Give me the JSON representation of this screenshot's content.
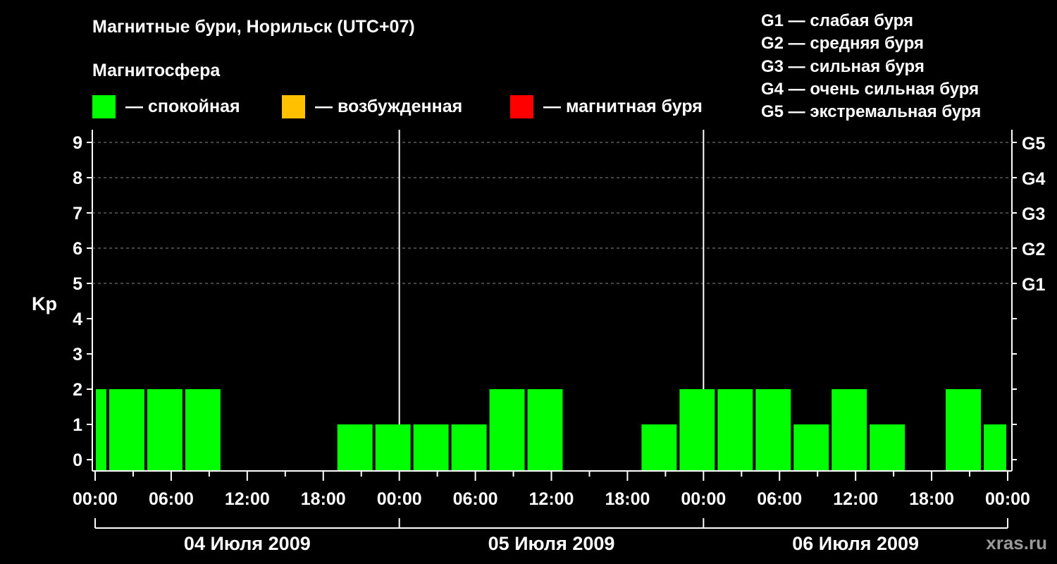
{
  "title": "Магнитные бури, Норильск (UTC+07)",
  "subtitle": "Магнитосфера",
  "legend": [
    {
      "label": "— спокойная",
      "color": "#00ff00"
    },
    {
      "label": "— возбужденная",
      "color": "#ffc000"
    },
    {
      "label": "— магнитная буря",
      "color": "#ff0000"
    }
  ],
  "g_legend": [
    "G1 — слабая буря",
    "G2 — средняя буря",
    "G3 — сильная буря",
    "G4 — очень сильная буря",
    "G5 — экстремальная буря"
  ],
  "watermark": "xras.ru",
  "chart_data": {
    "type": "bar",
    "ylabel": "Kp",
    "ylim": [
      0,
      9
    ],
    "y_ticks": [
      "0",
      "1",
      "2",
      "3",
      "4",
      "5",
      "6",
      "7",
      "8",
      "9"
    ],
    "right_ticks": [
      {
        "value": 5,
        "label": "G1"
      },
      {
        "value": 6,
        "label": "G2"
      },
      {
        "value": 7,
        "label": "G3"
      },
      {
        "value": 8,
        "label": "G4"
      },
      {
        "value": 9,
        "label": "G5"
      }
    ],
    "x_tick_labels": [
      "00:00",
      "06:00",
      "12:00",
      "18:00",
      "00:00",
      "06:00",
      "12:00",
      "18:00",
      "00:00",
      "06:00",
      "12:00",
      "18:00",
      "00:00"
    ],
    "days": [
      "04 Июля 2009",
      "05 Июля 2009",
      "06 Июля 2009"
    ],
    "period_hours": 3,
    "total_hours": 72,
    "first_interval_start_hour": -2,
    "values": [
      2,
      2,
      2,
      2,
      0,
      0,
      0,
      1,
      1,
      1,
      1,
      2,
      2,
      0,
      0,
      1,
      2,
      2,
      2,
      1,
      2,
      1,
      0,
      2,
      1
    ],
    "bar_color": "#00ff00",
    "grid": true
  }
}
